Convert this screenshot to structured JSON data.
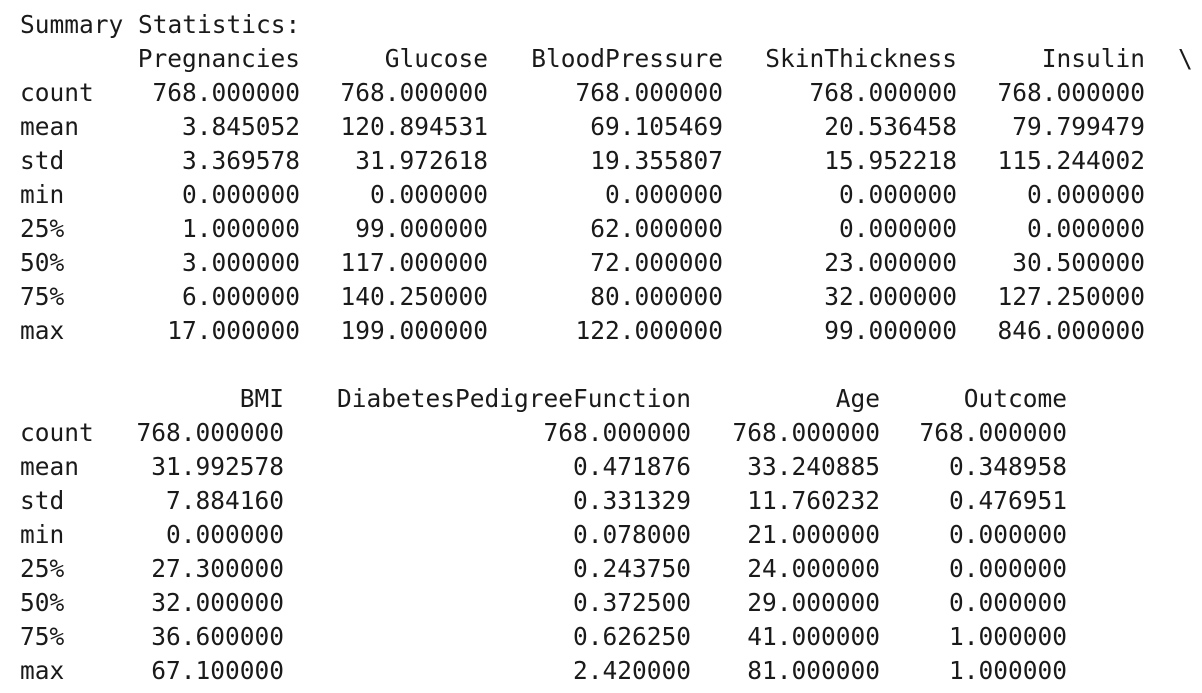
{
  "title": "Summary Statistics:",
  "continuation_marker": "\\",
  "tables": [
    {
      "columns": [
        "Pregnancies",
        "Glucose",
        "BloodPressure",
        "SkinThickness",
        "Insulin"
      ],
      "rows": [
        {
          "label": "count",
          "values": [
            "768.000000",
            "768.000000",
            "768.000000",
            "768.000000",
            "768.000000"
          ]
        },
        {
          "label": "mean",
          "values": [
            "3.845052",
            "120.894531",
            "69.105469",
            "20.536458",
            "79.799479"
          ]
        },
        {
          "label": "std",
          "values": [
            "3.369578",
            "31.972618",
            "19.355807",
            "15.952218",
            "115.244002"
          ]
        },
        {
          "label": "min",
          "values": [
            "0.000000",
            "0.000000",
            "0.000000",
            "0.000000",
            "0.000000"
          ]
        },
        {
          "label": "25%",
          "values": [
            "1.000000",
            "99.000000",
            "62.000000",
            "0.000000",
            "0.000000"
          ]
        },
        {
          "label": "50%",
          "values": [
            "3.000000",
            "117.000000",
            "72.000000",
            "23.000000",
            "30.500000"
          ]
        },
        {
          "label": "75%",
          "values": [
            "6.000000",
            "140.250000",
            "80.000000",
            "32.000000",
            "127.250000"
          ]
        },
        {
          "label": "max",
          "values": [
            "17.000000",
            "199.000000",
            "122.000000",
            "99.000000",
            "846.000000"
          ]
        }
      ]
    },
    {
      "columns": [
        "BMI",
        "DiabetesPedigreeFunction",
        "Age",
        "Outcome"
      ],
      "rows": [
        {
          "label": "count",
          "values": [
            "768.000000",
            "768.000000",
            "768.000000",
            "768.000000"
          ]
        },
        {
          "label": "mean",
          "values": [
            "31.992578",
            "0.471876",
            "33.240885",
            "0.348958"
          ]
        },
        {
          "label": "std",
          "values": [
            "7.884160",
            "0.331329",
            "11.760232",
            "0.476951"
          ]
        },
        {
          "label": "min",
          "values": [
            "0.000000",
            "0.078000",
            "21.000000",
            "0.000000"
          ]
        },
        {
          "label": "25%",
          "values": [
            "27.300000",
            "0.243750",
            "24.000000",
            "0.000000"
          ]
        },
        {
          "label": "50%",
          "values": [
            "32.000000",
            "0.372500",
            "29.000000",
            "0.000000"
          ]
        },
        {
          "label": "75%",
          "values": [
            "36.600000",
            "0.626250",
            "41.000000",
            "1.000000"
          ]
        },
        {
          "label": "max",
          "values": [
            "67.100000",
            "2.420000",
            "81.000000",
            "1.000000"
          ]
        }
      ]
    }
  ]
}
